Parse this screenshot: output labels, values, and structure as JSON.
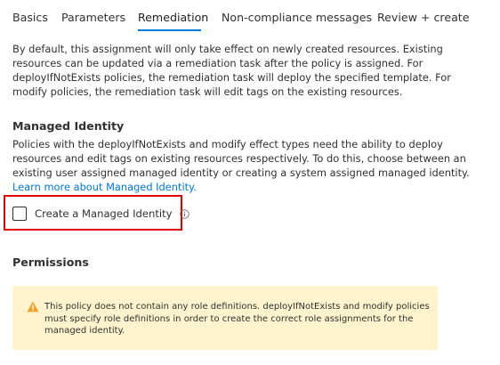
{
  "tabs": [
    {
      "label": "Basics",
      "active": false
    },
    {
      "label": "Parameters",
      "active": false
    },
    {
      "label": "Remediation",
      "active": true
    },
    {
      "label": "Non-compliance messages",
      "active": false
    },
    {
      "label": "Review + create",
      "active": false
    }
  ],
  "intro": {
    "lines": [
      "By default, this assignment will only take effect on newly created resources. Existing",
      "resources can be updated via a remediation task after the policy is assigned. For",
      "deployIfNotExists policies, the remediation task will deploy the specified template. For",
      "modify policies, the remediation task will edit tags on the existing resources."
    ]
  },
  "managed_identity": {
    "title": "Managed Identity",
    "description_lines": [
      "Policies with the deployIfNotExists and modify effect types need the ability to deploy",
      "resources and edit tags on existing resources respectively. To do this, choose between an",
      "existing user assigned managed identity or creating a system assigned managed identity."
    ],
    "learn_more_link": "Learn more about Managed Identity.",
    "checkbox_label": "Create a Managed Identity",
    "checkbox_checked": false,
    "info_icon": "info-circle-icon"
  },
  "permissions": {
    "title": "Permissions",
    "warning_icon": "warning-triangle-icon",
    "warning_lines": [
      "This policy does not contain any role definitions. deployIfNotExists and modify policies",
      "must specify role definitions in order to create the correct role assignments for the",
      "managed identity."
    ]
  },
  "colors": {
    "accent": "#0078d4",
    "highlight_border": "#e00000",
    "warning_background": "#fff4ce",
    "warning_icon": "#f2a12b"
  }
}
